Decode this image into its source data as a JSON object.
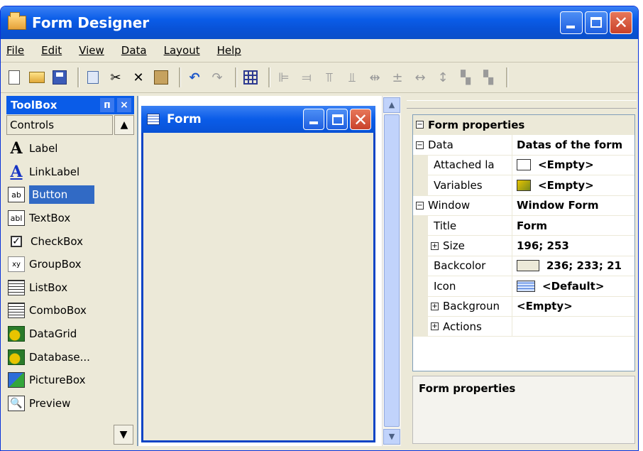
{
  "window": {
    "title": "Form Designer"
  },
  "menu": [
    "File",
    "Edit",
    "View",
    "Data",
    "Layout",
    "Help"
  ],
  "toolbox": {
    "title": "ToolBox",
    "pin": "ᴨ",
    "close": "×",
    "group": "Controls",
    "items": [
      {
        "label": "Label",
        "icon": "label-icon"
      },
      {
        "label": "LinkLabel",
        "icon": "linklabel-icon"
      },
      {
        "label": "Button",
        "icon": "button-icon"
      },
      {
        "label": "TextBox",
        "icon": "textbox-icon"
      },
      {
        "label": "CheckBox",
        "icon": "checkbox-icon"
      },
      {
        "label": "GroupBox",
        "icon": "groupbox-icon"
      },
      {
        "label": "ListBox",
        "icon": "listbox-icon"
      },
      {
        "label": "ComboBox",
        "icon": "combobox-icon"
      },
      {
        "label": "DataGrid",
        "icon": "datagrid-icon"
      },
      {
        "label": "Database...",
        "icon": "database-icon"
      },
      {
        "label": "PictureBox",
        "icon": "picturebox-icon"
      },
      {
        "label": "Preview",
        "icon": "preview-icon"
      }
    ],
    "selected": "Button"
  },
  "form": {
    "title": "Form"
  },
  "properties": {
    "header": "Form properties",
    "rows": [
      {
        "name": "Data",
        "value": "Datas of the form",
        "expander": "⊟",
        "level": 0
      },
      {
        "name": "Attached la",
        "value": "<Empty>",
        "level": 1
      },
      {
        "name": "Variables",
        "value": "<Empty>",
        "level": 1
      },
      {
        "name": "Window",
        "value": "Window Form",
        "expander": "⊟",
        "level": 0
      },
      {
        "name": "Title",
        "value": "Form",
        "level": 1
      },
      {
        "name": "Size",
        "value": "196; 253",
        "expander": "⊞",
        "level": 1
      },
      {
        "name": "Backcolor",
        "value": "236; 233; 21",
        "level": 1
      },
      {
        "name": "Icon",
        "value": "<Default>",
        "level": 1
      },
      {
        "name": "Backgroun",
        "value": "<Empty>",
        "expander": "⊞",
        "level": 1
      },
      {
        "name": "Actions",
        "value": "",
        "expander": "⊞",
        "level": 1
      }
    ],
    "description": "Form properties"
  },
  "colors": {
    "titlebar": "#0a5ce8",
    "selection": "#316ac5",
    "backcolor": "#ece9d8"
  }
}
